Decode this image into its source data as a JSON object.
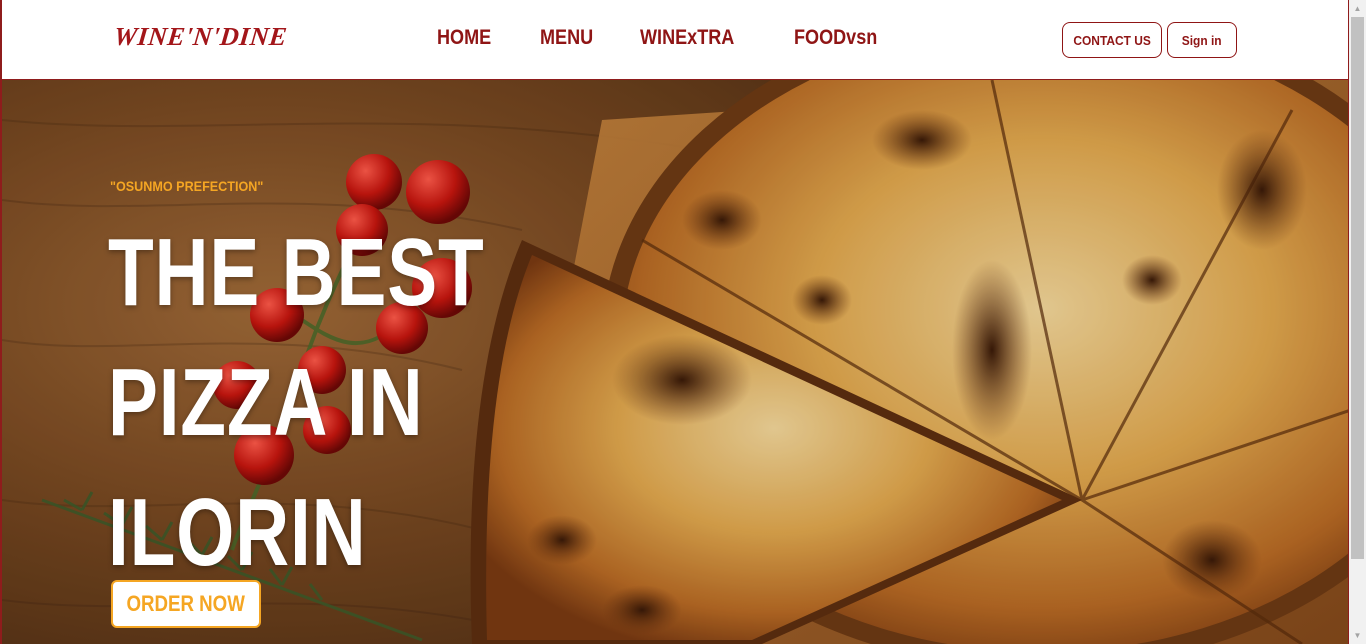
{
  "brand": {
    "logo_text": "WINE'N'DINE",
    "accent_color": "#8f1515",
    "highlight_color": "#f5a623"
  },
  "nav": {
    "links": [
      {
        "label": "HOME"
      },
      {
        "label": "MENU"
      },
      {
        "label": "WINExTRA"
      },
      {
        "label": "FOODvsn"
      }
    ],
    "contact_label": "CONTACT US",
    "signin_label": "Sign in"
  },
  "hero": {
    "tagline": "\"OSUNMO PREFECTION\"",
    "headline": [
      "THE BEST",
      "PIZZA IN",
      "ILORIN"
    ],
    "cta_label": "ORDER NOW",
    "background_image": "pizza-on-wooden-board-with-cherry-tomatoes-and-rosemary"
  }
}
